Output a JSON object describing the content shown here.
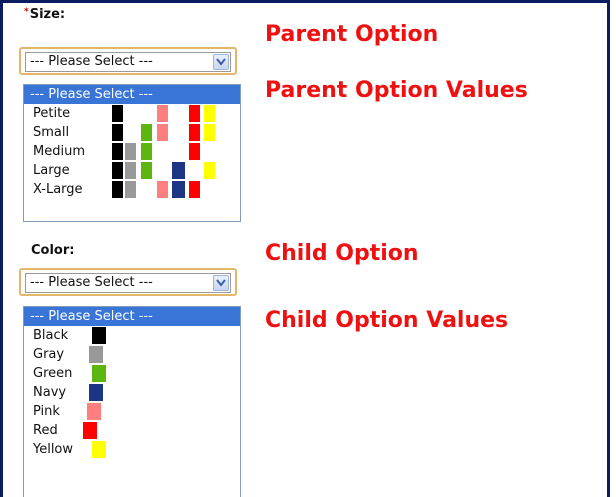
{
  "size": {
    "label": "Size:",
    "required_mark": "*",
    "select_value": "--- Please Select ---",
    "options": [
      {
        "label": "--- Please Select ---",
        "selected": true,
        "swatches": []
      },
      {
        "label": "Petite",
        "swatches": [
          "Black",
          "Pink",
          "Red",
          "Yellow"
        ]
      },
      {
        "label": "Small",
        "swatches": [
          "Black",
          "Green",
          "Pink",
          "Red",
          "Yellow"
        ]
      },
      {
        "label": "Medium",
        "swatches": [
          "Black",
          "Gray",
          "Green",
          "Red"
        ]
      },
      {
        "label": "Large",
        "swatches": [
          "Black",
          "Gray",
          "Green",
          "Navy",
          "Yellow"
        ]
      },
      {
        "label": "X-Large",
        "swatches": [
          "Black",
          "Gray",
          "Pink",
          "Navy",
          "Red"
        ]
      }
    ]
  },
  "color": {
    "label": "Color:",
    "select_value": "--- Please Select ---",
    "options": [
      {
        "label": "--- Please Select ---",
        "selected": true
      },
      {
        "label": "Black",
        "color": "#000000"
      },
      {
        "label": "Gray",
        "color": "#999999"
      },
      {
        "label": "Green",
        "color": "#5db610"
      },
      {
        "label": "Navy",
        "color": "#1c3585"
      },
      {
        "label": "Pink",
        "color": "#ff7f7f"
      },
      {
        "label": "Red",
        "color": "#ff0000"
      },
      {
        "label": "Yellow",
        "color": "#ffff00"
      }
    ]
  },
  "annotations": {
    "parent_option": "Parent Option",
    "parent_option_values": "Parent Option Values",
    "child_option": "Child Option",
    "child_option_values": "Child Option Values"
  },
  "colors": {
    "frame": "#0a1d63",
    "annotation": "#ee1111",
    "select_highlight": "#3875d7",
    "select_border": "#e2b76b"
  }
}
